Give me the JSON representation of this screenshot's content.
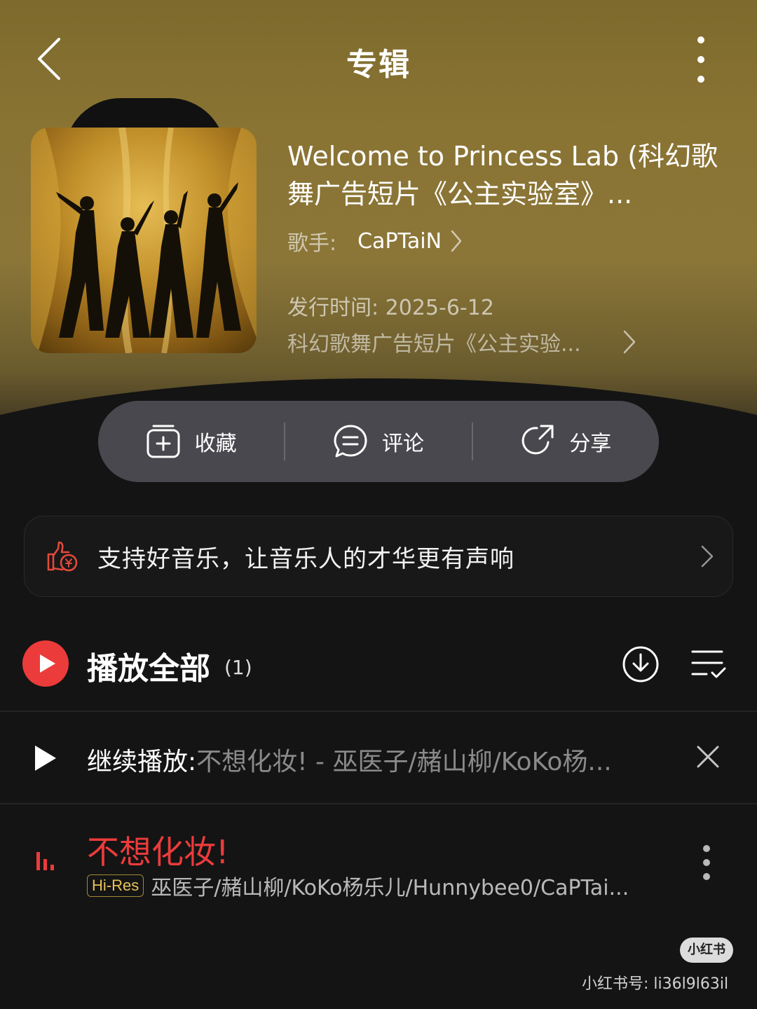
{
  "header": {
    "title": "专辑",
    "back_icon": "chevron-left-icon",
    "more_icon": "more-vertical-icon"
  },
  "album": {
    "title": "Welcome to Princess Lab (科幻歌舞广告短片《公主实验室》...",
    "artist_label": "歌手:",
    "artist_name": "CaPTaiN",
    "release": "发行时间: 2025-6-12",
    "description": "科幻歌舞广告短片《公主实验..."
  },
  "actions": {
    "collect": "收藏",
    "comment": "评论",
    "share": "分享"
  },
  "support": {
    "text": "支持好音乐，让音乐人的才华更有声响"
  },
  "playlist": {
    "play_all_label": "播放全部",
    "count": "(1)"
  },
  "resume": {
    "label": "继续播放:",
    "song": "不想化妆!",
    "artists": " - 巫医子/赭山柳/KoKo杨..."
  },
  "tracks": [
    {
      "title": "不想化妆!",
      "badge": "Hi-Res",
      "artists": "巫医子/赭山柳/KoKo杨乐儿/Hunnybee0/CaPTai..."
    }
  ],
  "watermark": {
    "badge": "小红书",
    "id": "小红书号: li36l9l63il"
  },
  "colors": {
    "accent_red": "#ec3b3b",
    "header_gold": "#8a7434",
    "hires_gold": "#e8c158",
    "background": "#141414"
  }
}
